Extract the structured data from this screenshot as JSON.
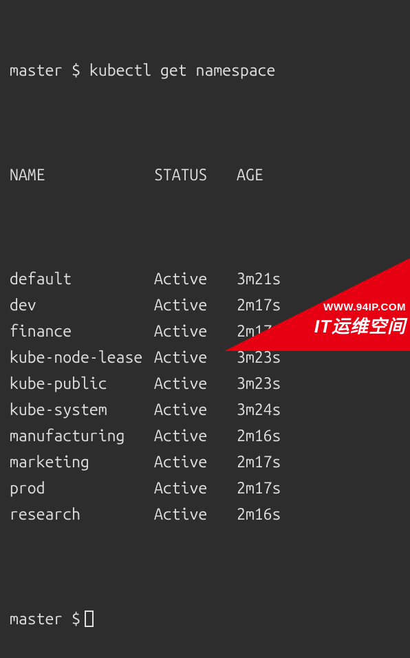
{
  "prompt": {
    "host": "master",
    "symbol": "$",
    "command": "kubectl get namespace"
  },
  "table": {
    "headers": {
      "name": "NAME",
      "status": "STATUS",
      "age": "AGE"
    },
    "rows": [
      {
        "name": "default",
        "status": "Active",
        "age": "3m21s"
      },
      {
        "name": "dev",
        "status": "Active",
        "age": "2m17s"
      },
      {
        "name": "finance",
        "status": "Active",
        "age": "2m17s"
      },
      {
        "name": "kube-node-lease",
        "status": "Active",
        "age": "3m23s"
      },
      {
        "name": "kube-public",
        "status": "Active",
        "age": "3m23s"
      },
      {
        "name": "kube-system",
        "status": "Active",
        "age": "3m24s"
      },
      {
        "name": "manufacturing",
        "status": "Active",
        "age": "2m16s"
      },
      {
        "name": "marketing",
        "status": "Active",
        "age": "2m17s"
      },
      {
        "name": "prod",
        "status": "Active",
        "age": "2m17s"
      },
      {
        "name": "research",
        "status": "Active",
        "age": "2m16s"
      }
    ]
  },
  "prompt2": {
    "host": "master",
    "symbol": "$"
  },
  "watermark": {
    "url": "WWW.94IP.COM",
    "label": "IT运维空间"
  }
}
